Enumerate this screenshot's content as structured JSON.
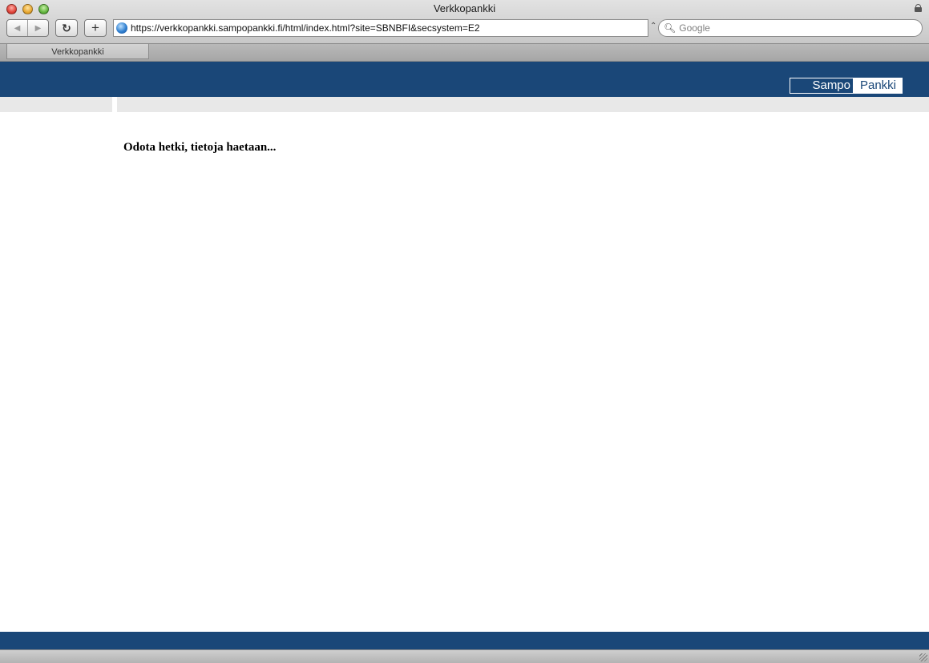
{
  "browser": {
    "window_title": "Verkkopankki",
    "url": "https://verkkopankki.sampopankki.fi/html/index.html?site=SBNBFI&secsystem=E2",
    "search_placeholder": "Google",
    "tabs": [
      {
        "label": "Verkkopankki",
        "active": true
      }
    ],
    "buttons": {
      "back_glyph": "◀",
      "forward_glyph": "▶",
      "reload_glyph": "↻",
      "add_bookmark_glyph": "+"
    }
  },
  "bank": {
    "logo_part1": "Sampo",
    "logo_part2": "Pankki",
    "loading_message": "Odota hetki, tietoja haetaan..."
  },
  "colors": {
    "brand_blue": "#1a4778",
    "subbar_gray": "#e8e8e8"
  }
}
